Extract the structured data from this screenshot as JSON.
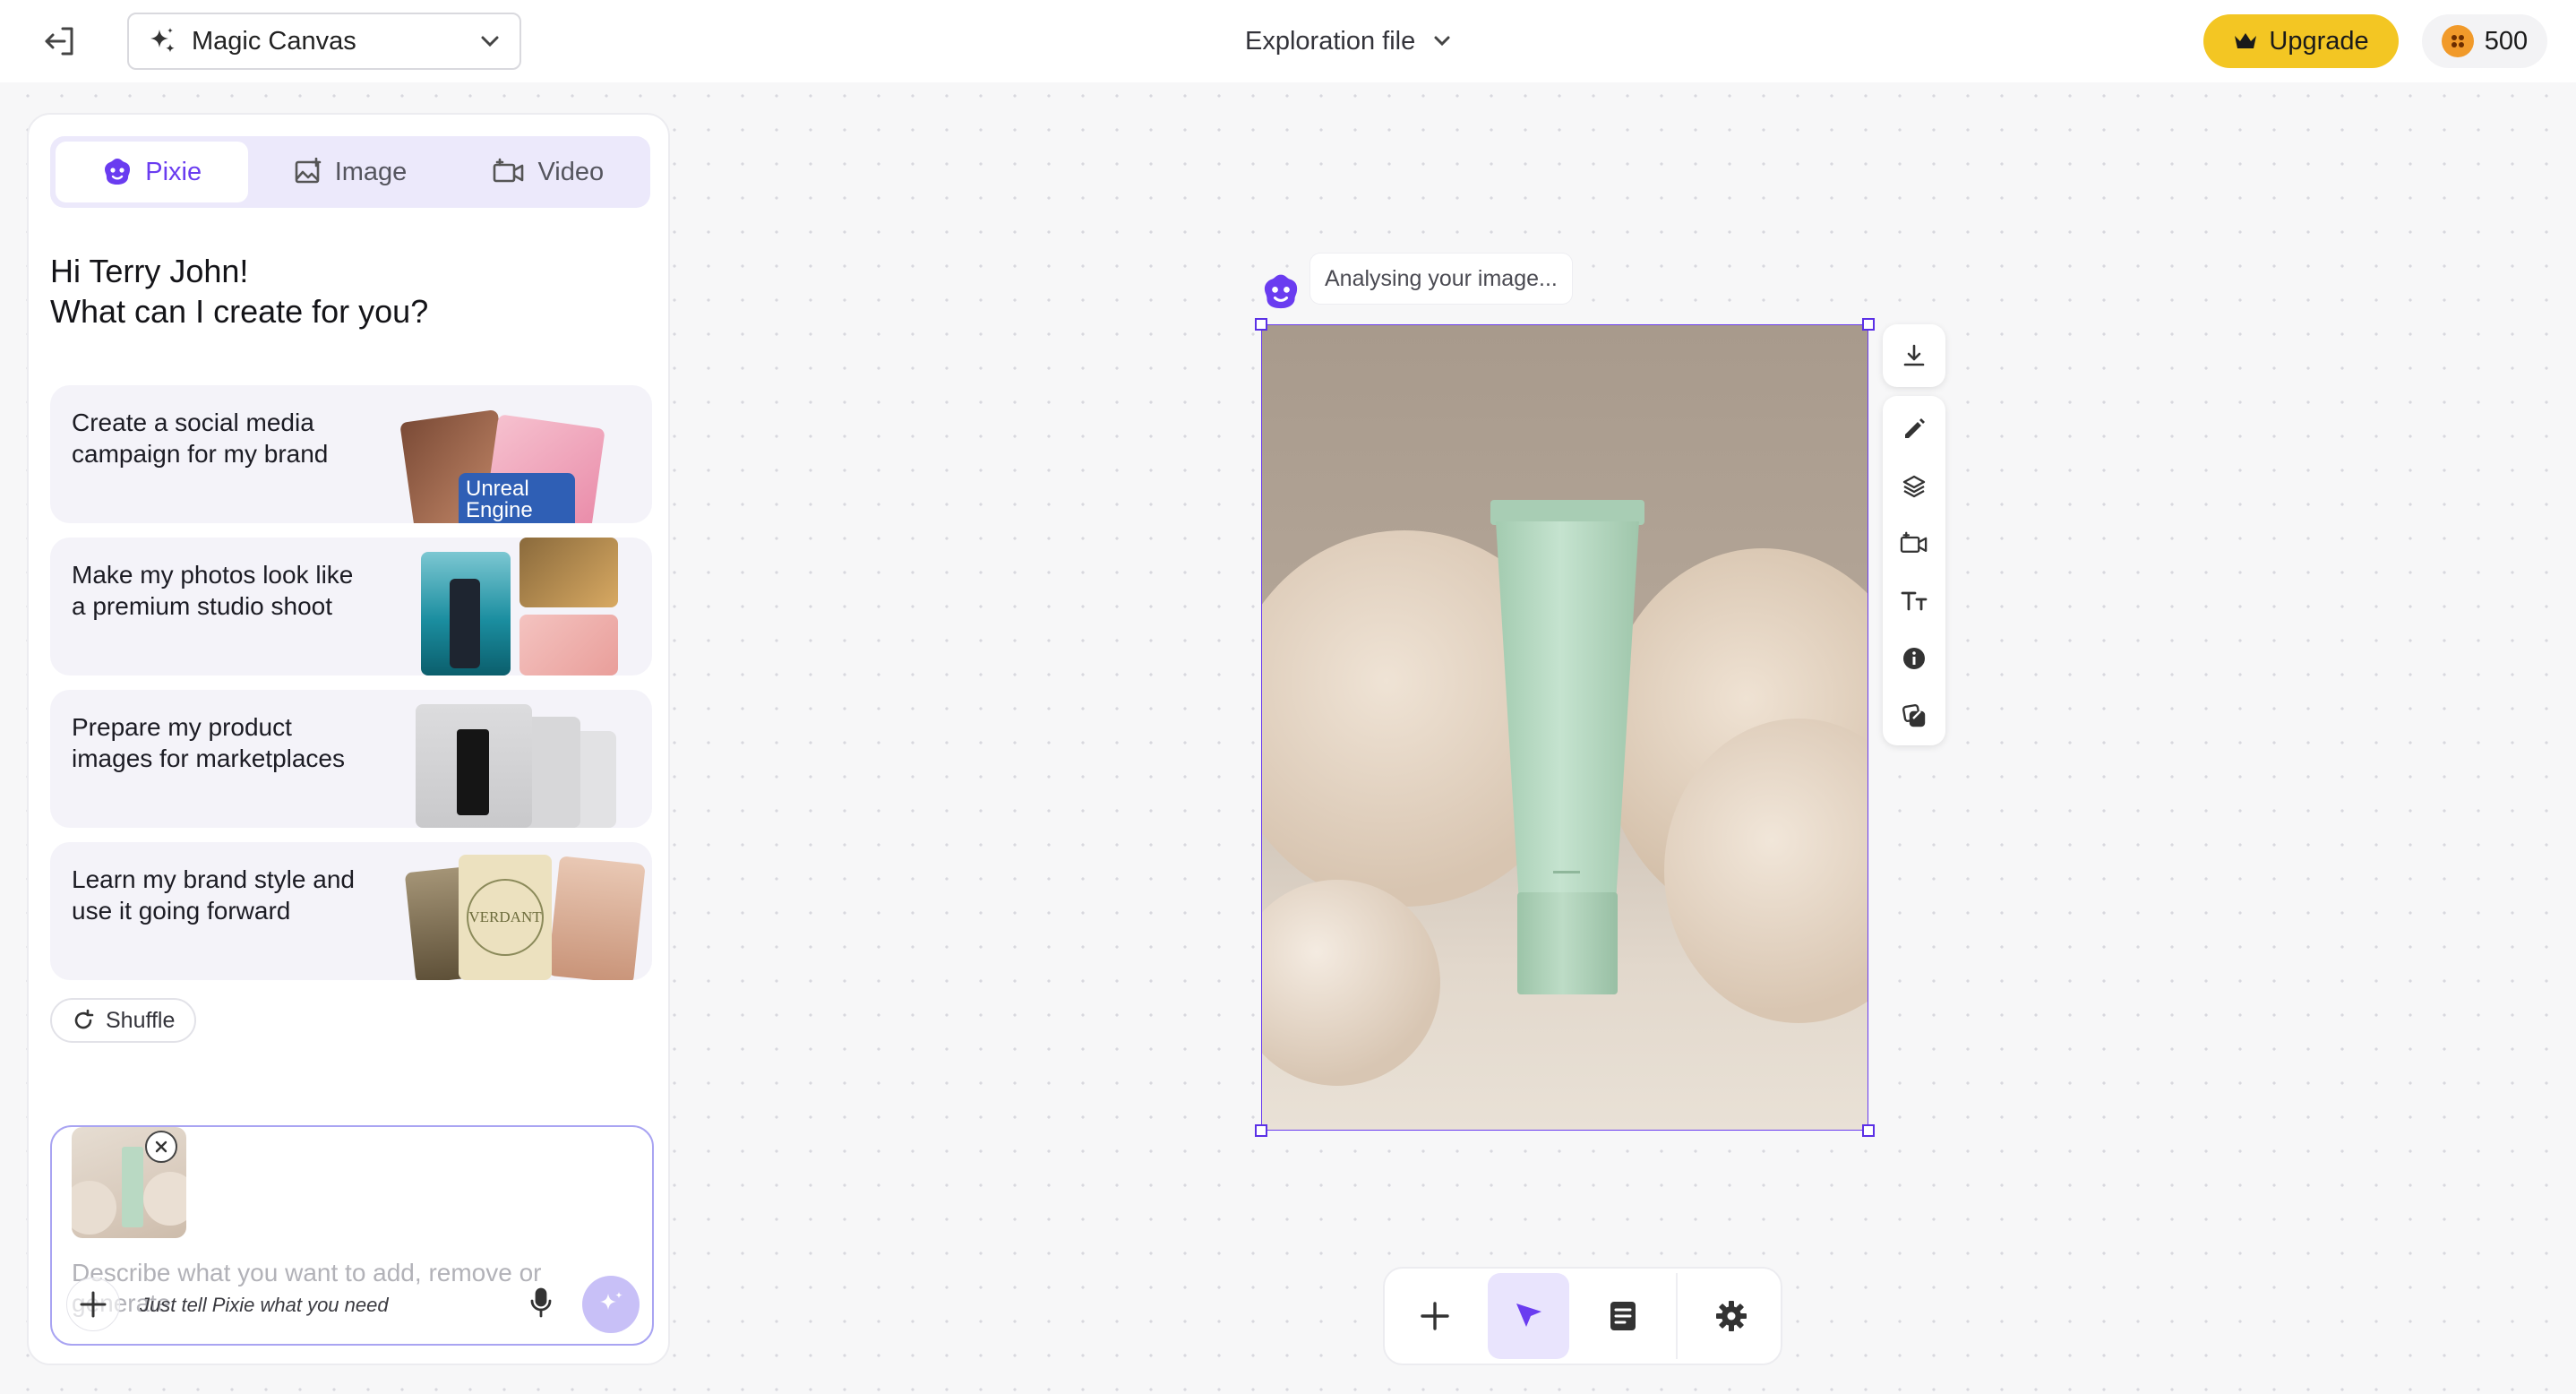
{
  "topbar": {
    "app_name": "Magic Canvas",
    "file_name": "Exploration file",
    "upgrade_label": "Upgrade",
    "credits": "500"
  },
  "panel": {
    "tabs": [
      {
        "label": "Pixie",
        "icon": "pixie-icon",
        "active": true
      },
      {
        "label": "Image",
        "icon": "image-icon",
        "active": false
      },
      {
        "label": "Video",
        "icon": "video-icon",
        "active": false
      }
    ],
    "greeting_line1": "Hi Terry John!",
    "greeting_line2": "What can I create for you?",
    "suggestions": [
      {
        "line1": "Create a social media",
        "line2": "campaign for my brand",
        "thumb_text": "Unreal Engine"
      },
      {
        "line1": "Make my photos look like",
        "line2": "a premium studio shoot"
      },
      {
        "line1": "Prepare my product",
        "line2": "images for marketplaces"
      },
      {
        "line1": "Learn my brand style and",
        "line2": "use it going forward",
        "thumb_text": "VERDANT"
      }
    ],
    "shuffle_label": "Shuffle",
    "composer": {
      "placeholder": "Describe what you want to add, remove or generate",
      "hint": "Just tell Pixie what you need"
    }
  },
  "canvas": {
    "status_text": "Analysing your image..."
  },
  "colors": {
    "accent": "#6a3cf0",
    "upgrade": "#f3c623",
    "coin": "#f19a2a",
    "tab_bg": "#ece9fb",
    "tube": "#b9d9c3"
  }
}
